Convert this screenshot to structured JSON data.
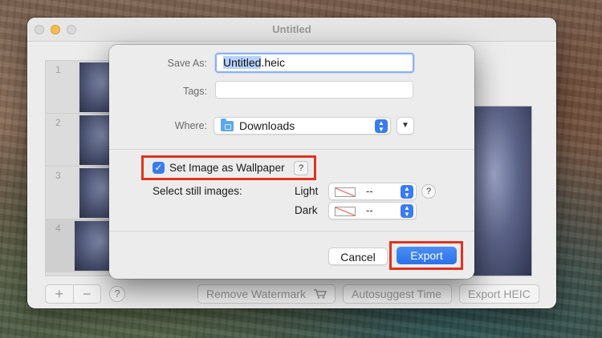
{
  "window": {
    "title": "Untitled"
  },
  "frames": [
    {
      "number": "1"
    },
    {
      "number": "2"
    },
    {
      "number": "3"
    },
    {
      "number": "4"
    }
  ],
  "bottom_bar": {
    "add": "+",
    "remove": "−",
    "help": "?",
    "remove_watermark": "Remove Watermark",
    "autosuggest_time": "Autosuggest Time",
    "export_heic": "Export HEIC"
  },
  "sheet": {
    "save_as_label": "Save As:",
    "filename_selected": "Untitled",
    "filename_ext": ".heic",
    "tags_label": "Tags:",
    "tags_value": "",
    "where_label": "Where:",
    "where_value": "Downloads",
    "wallpaper_checkbox": {
      "label": "Set Image as Wallpaper",
      "checked": true,
      "help": "?"
    },
    "still_images_label": "Select still images:",
    "light_label": "Light",
    "light_value": "--",
    "light_help": "?",
    "dark_label": "Dark",
    "dark_value": "--",
    "cancel_label": "Cancel",
    "export_label": "Export"
  },
  "colors": {
    "accent": "#3a7cf0",
    "highlight_box": "#e2321f",
    "traffic_minimize": "#f5bd4f"
  },
  "icons": {
    "checkmark": "checkmark-icon",
    "folder": "folder-icon",
    "stepper": "chevron-updown-icon",
    "expand": "chevron-down-icon",
    "cart": "cart-icon"
  }
}
